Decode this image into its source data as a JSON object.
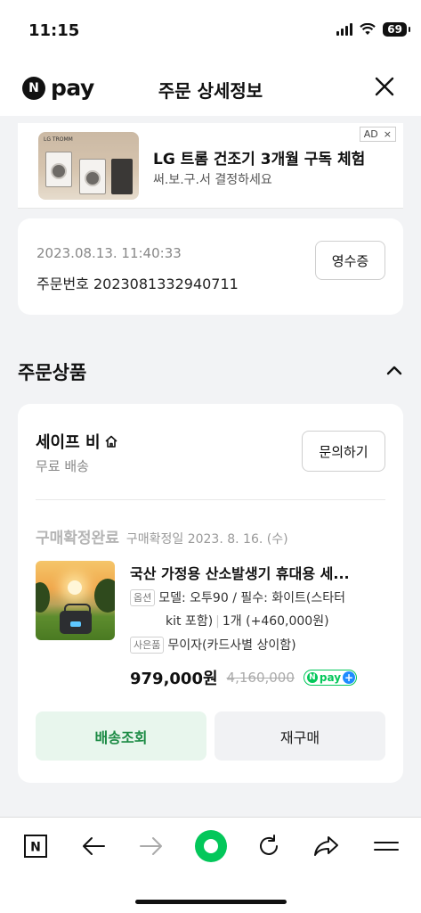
{
  "status_bar": {
    "time": "11:15",
    "battery": "69"
  },
  "header": {
    "logo_badge": "N",
    "logo_text": "pay",
    "title": "주문 상세정보",
    "close_icon": "close-icon"
  },
  "ad": {
    "title": "LG 트롬 건조기 3개월 구독 체험",
    "subtitle": "써.보.구.서 결정하세요",
    "badge": "AD",
    "badge_close": "×",
    "image_brand": "LG TROMM"
  },
  "order": {
    "datetime": "2023.08.13. 11:40:33",
    "order_number": "주문번호 2023081332940711",
    "receipt_label": "영수증"
  },
  "section": {
    "title": "주문상품",
    "toggle_icon": "chevron-up-icon"
  },
  "product": {
    "seller": "세이프 비",
    "seller_icon": "home-icon",
    "shipping": "무료 배송",
    "inquiry_label": "문의하기",
    "status": "구매확정완료",
    "status_date": "구매확정일 2023. 8. 16. (수)",
    "name": "국산 가정용 산소발생기 휴대용 세...",
    "option_tag": "옵션",
    "option_line1": "모델: 오투90 / 필수: 화이트(스타터",
    "option_line2a": "kit 포함)",
    "option_line2b": "1개 (+460,000원)",
    "gift_tag": "사은품",
    "gift_text": "무이자(카드사별 상이함)",
    "price": "979,000원",
    "original_price": "4,160,000",
    "npay_n": "N",
    "npay_text": "pay",
    "npay_plus": "+",
    "track_label": "배송조회",
    "rebuy_label": "재구매"
  },
  "toolbar": {
    "items": [
      "naver-home-icon",
      "back-arrow-icon",
      "forward-arrow-icon",
      "green-dot-icon",
      "reload-icon",
      "share-icon",
      "menu-icon"
    ],
    "n_label": "N"
  },
  "colors": {
    "brand_green": "#03c75a",
    "track_bg": "#e8f6ed",
    "track_text": "#1a8a43",
    "page_bg": "#f2f3f5"
  }
}
